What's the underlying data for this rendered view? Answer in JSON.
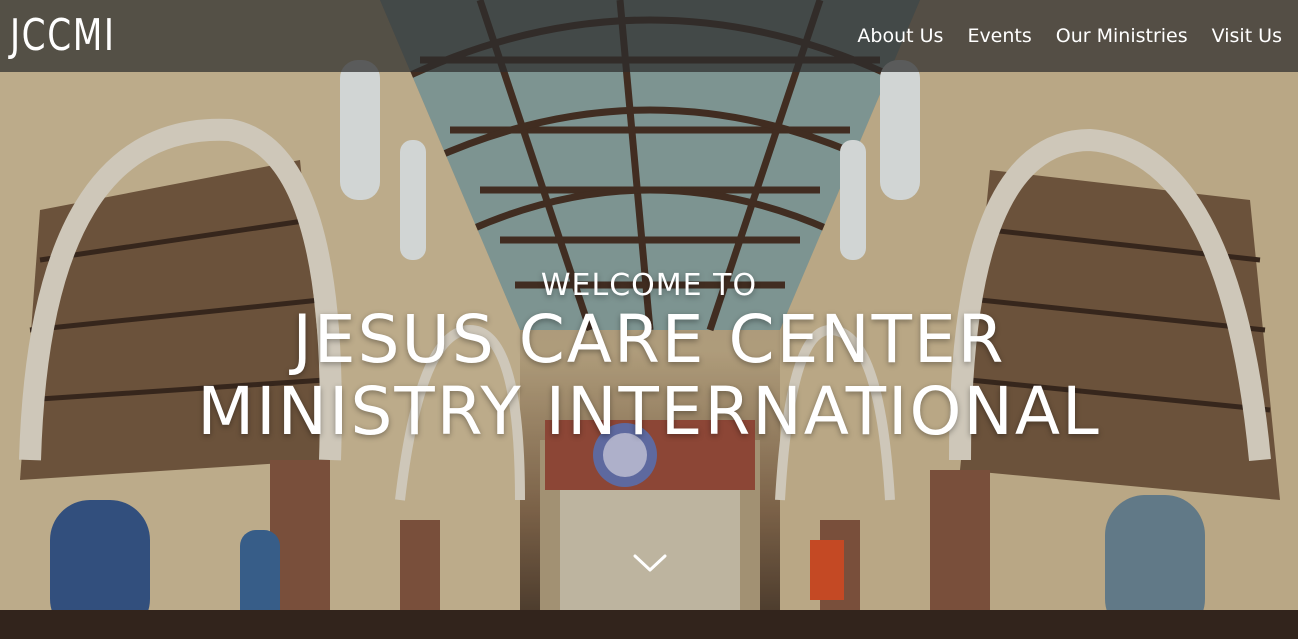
{
  "navbar": {
    "brand": "JCCMI",
    "links": [
      "About Us",
      "Events",
      "Our Ministries",
      "Visit Us"
    ]
  },
  "hero": {
    "welcome": "WELCOME TO",
    "title_line1": "JESUS CARE CENTER",
    "title_line2": "MINISTRY INTERNATIONAL",
    "scroll_icon": "chevron-down-icon"
  },
  "colors": {
    "navbar_bg": "#2d2d2d",
    "text": "#ffffff"
  }
}
